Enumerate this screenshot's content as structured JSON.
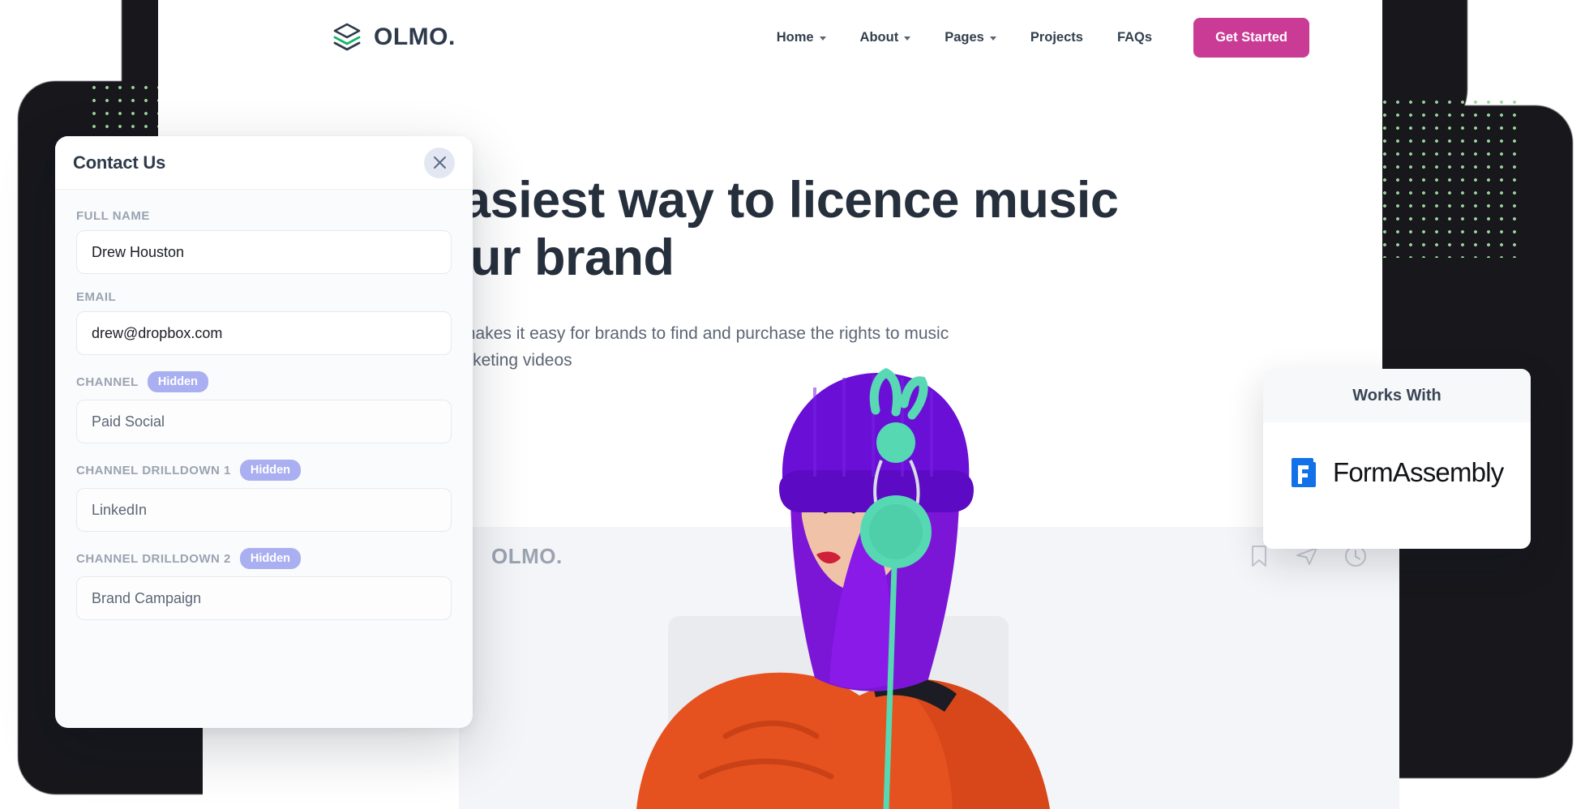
{
  "header": {
    "logo": {
      "text": "OLMO.",
      "icon": "layers-stack-icon"
    },
    "nav": [
      {
        "label": "Home",
        "has_dropdown": true
      },
      {
        "label": "About",
        "has_dropdown": true
      },
      {
        "label": "Pages",
        "has_dropdown": true
      },
      {
        "label": "Projects",
        "has_dropdown": false
      },
      {
        "label": "FAQs",
        "has_dropdown": false
      }
    ],
    "cta": {
      "label": "Get Started",
      "color": "#ca3b96"
    }
  },
  "hero": {
    "title": "The easiest way to licence music for your brand",
    "subtitle": "Our marketplace makes it easy for brands to find and purchase the rights to music for use in their marketing videos"
  },
  "mock": {
    "logo": "OLMO.",
    "icons": [
      "bookmark-icon",
      "send-icon",
      "clock-icon"
    ]
  },
  "modal": {
    "title": "Contact Us",
    "close_label": "Close",
    "fields": [
      {
        "label": "FULL NAME",
        "badge": "",
        "value": "Drew Houston",
        "muted": false
      },
      {
        "label": "EMAIL",
        "badge": "",
        "value": "drew@dropbox.com",
        "muted": false
      },
      {
        "label": "CHANNEL",
        "badge": "Hidden",
        "value": "Paid Social",
        "muted": true
      },
      {
        "label": "CHANNEL DRILLDOWN 1",
        "badge": "Hidden",
        "value": "LinkedIn",
        "muted": true
      },
      {
        "label": "CHANNEL DRILLDOWN 2",
        "badge": "Hidden",
        "value": "Brand Campaign",
        "muted": true
      }
    ],
    "badge_color": "#a9aff0"
  },
  "works_with": {
    "title": "Works With",
    "partner": "FormAssembly",
    "partner_icon": "formassembly-f-icon",
    "partner_color": "#1271e8"
  }
}
